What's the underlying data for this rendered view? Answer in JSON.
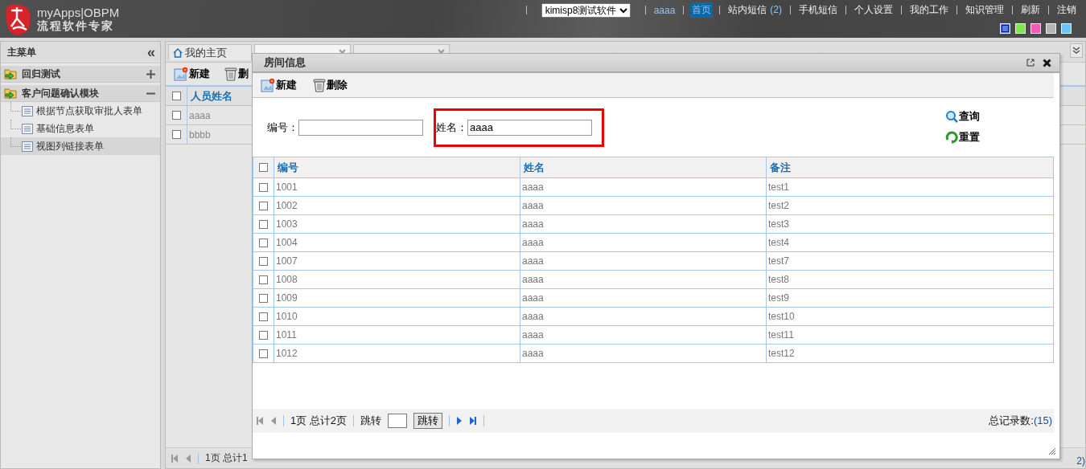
{
  "header": {
    "logo_title": "myApps|OBPM",
    "logo_subtitle": "流程软件专家",
    "app_select": "kimisp8测试软件",
    "nav_links": [
      {
        "label": "aaaa",
        "selected": false,
        "kind": "user"
      },
      {
        "label": "首页",
        "selected": true,
        "kind": "link"
      },
      {
        "label": "站内短信",
        "count": "(2)",
        "selected": false,
        "kind": "link"
      },
      {
        "label": "手机短信",
        "selected": false,
        "kind": "link"
      },
      {
        "label": "个人设置",
        "selected": false,
        "kind": "link"
      },
      {
        "label": "我的工作",
        "selected": false,
        "kind": "link"
      },
      {
        "label": "知识管理",
        "selected": false,
        "kind": "link"
      },
      {
        "label": "刷新",
        "selected": false,
        "kind": "link"
      },
      {
        "label": "注销",
        "selected": false,
        "kind": "link"
      }
    ],
    "theme_swatches": [
      {
        "color": "#5b7de8",
        "selected": true
      },
      {
        "color": "#7ee84a",
        "selected": false
      },
      {
        "color": "#f25bb8",
        "selected": false
      },
      {
        "color": "#b4b4b4",
        "selected": false
      },
      {
        "color": "#6cc3f5",
        "selected": false
      }
    ]
  },
  "sidebar": {
    "title": "主菜单",
    "collapse_icon": "«",
    "items": [
      {
        "label": "回归测试",
        "expanded": false
      },
      {
        "label": "客户问题确认模块",
        "expanded": true,
        "children": [
          {
            "label": "根据节点获取审批人表单",
            "selected": false
          },
          {
            "label": "基础信息表单",
            "selected": false
          },
          {
            "label": "视图列链接表单",
            "selected": true
          }
        ]
      }
    ]
  },
  "main": {
    "tabs": [
      {
        "label": "我的主页",
        "selected": false,
        "kind": "home"
      },
      {
        "selected": true,
        "kind": "closable"
      },
      {
        "selected": false,
        "kind": "closable"
      }
    ],
    "toolbar": [
      "新建",
      "删"
    ],
    "table": {
      "columns": [
        "人员姓名"
      ],
      "all_checked": false,
      "rows": [
        {
          "cells": [
            "aaaa"
          ],
          "checked": false
        },
        {
          "cells": [
            "bbbb"
          ],
          "checked": false
        }
      ]
    },
    "pager": "1页 总计1",
    "record_count_fragment": "2)"
  },
  "dialog": {
    "title": "房间信息",
    "toolbar": [
      "新建",
      "删除"
    ],
    "search": {
      "fields": [
        {
          "label": "编号：",
          "highlighted": false
        },
        {
          "label": "姓名：",
          "value": "aaaa",
          "highlighted": true
        }
      ],
      "buttons": [
        {
          "label": "查询",
          "kind": "search"
        },
        {
          "label": "重置",
          "kind": "reset"
        }
      ]
    },
    "table": {
      "columns": [
        "编号",
        "姓名",
        "备注"
      ],
      "all_checked": false,
      "rows": [
        {
          "cells": [
            "1001",
            "aaaa",
            "test1"
          ],
          "checked": false
        },
        {
          "cells": [
            "1002",
            "aaaa",
            "test2"
          ],
          "checked": false
        },
        {
          "cells": [
            "1003",
            "aaaa",
            "test3"
          ],
          "checked": false
        },
        {
          "cells": [
            "1004",
            "aaaa",
            "test4"
          ],
          "checked": false
        },
        {
          "cells": [
            "1007",
            "aaaa",
            "test7"
          ],
          "checked": false
        },
        {
          "cells": [
            "1008",
            "aaaa",
            "test8"
          ],
          "checked": false
        },
        {
          "cells": [
            "1009",
            "aaaa",
            "test9"
          ],
          "checked": false
        },
        {
          "cells": [
            "1010",
            "aaaa",
            "test10"
          ],
          "checked": false
        },
        {
          "cells": [
            "1011",
            "aaaa",
            "test11"
          ],
          "checked": false
        },
        {
          "cells": [
            "1012",
            "aaaa",
            "test12"
          ],
          "checked": false
        }
      ]
    },
    "pager": {
      "page_info": "1页 总计2页",
      "jump_label": "跳转",
      "jump_button": "跳转",
      "total": "总记录数:",
      "total_count": "(15)"
    }
  }
}
